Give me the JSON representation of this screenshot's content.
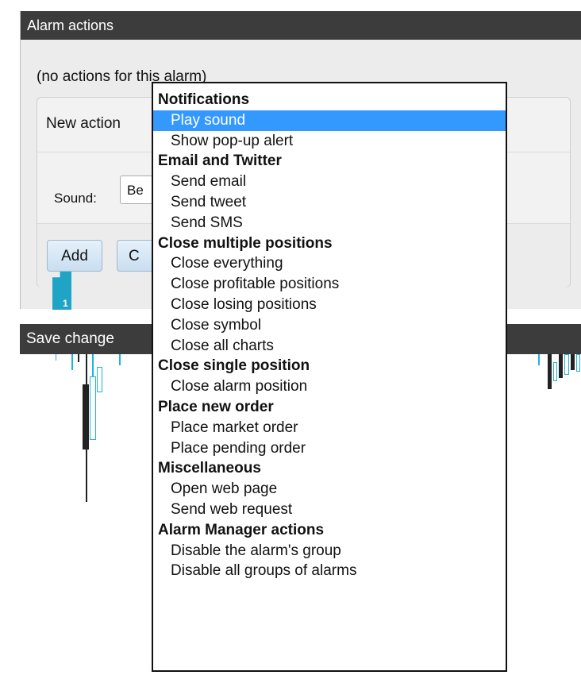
{
  "panel": {
    "title": "Alarm actions",
    "no_actions_text": "(no actions for this alarm)",
    "new_action_label": "New action",
    "sound_label": "Sound:",
    "sound_value": "Be",
    "add_label": "Add",
    "cancel_label": "C"
  },
  "marker": {
    "number": "1"
  },
  "save_bar": {
    "label": "Save change"
  },
  "menu": {
    "groups": [
      {
        "label": "Notifications",
        "items": [
          "Play sound",
          "Show pop-up alert"
        ]
      },
      {
        "label": "Email and Twitter",
        "items": [
          "Send email",
          "Send tweet",
          "Send SMS"
        ]
      },
      {
        "label": "Close multiple positions",
        "items": [
          "Close everything",
          "Close profitable positions",
          "Close losing positions",
          "Close symbol",
          "Close all charts"
        ]
      },
      {
        "label": "Close single position",
        "items": [
          "Close alarm position"
        ]
      },
      {
        "label": "Place new order",
        "items": [
          "Place market order",
          "Place pending order"
        ]
      },
      {
        "label": "Miscellaneous",
        "items": [
          "Open web page",
          "Send web request"
        ]
      },
      {
        "label": "Alarm Manager actions",
        "items": [
          "Disable the alarm's group",
          "Disable all groups of alarms"
        ]
      }
    ],
    "selected": "Play sound"
  },
  "colors": {
    "title_bar": "#3c3c3c",
    "selection": "#3399ff",
    "marker": "#1fa4c6",
    "candle_up": "#1fb3d6",
    "candle_down": "#222222"
  }
}
